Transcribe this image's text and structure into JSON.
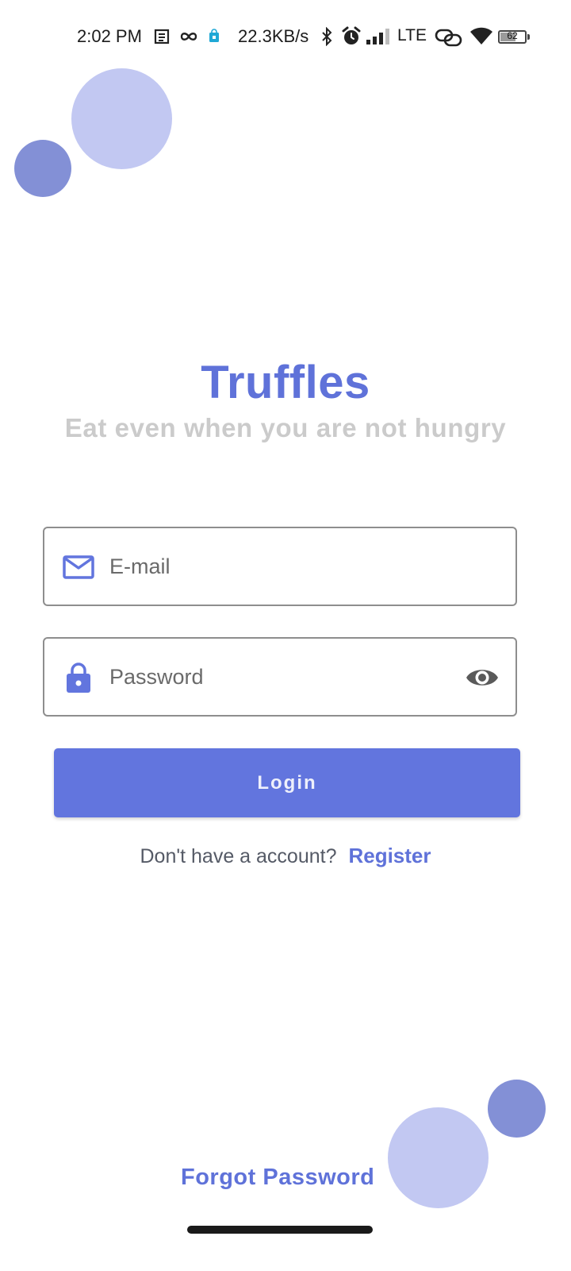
{
  "status_bar": {
    "time": "2:02 PM",
    "network_speed": "22.3KB/s",
    "network_type": "LTE",
    "battery_level": "62",
    "battery_fraction": 0.62,
    "icons": [
      "notes-icon",
      "infinity-icon",
      "shopping-bag-icon",
      "bluetooth-icon",
      "alarm-icon",
      "signal-icon",
      "link-icon",
      "wifi-icon",
      "battery-icon"
    ]
  },
  "app": {
    "title": "Truffles",
    "tagline": "Eat even when you are not hungry"
  },
  "form": {
    "email_placeholder": "E-mail",
    "email_value": "",
    "email_icon": "mail-icon",
    "password_placeholder": "Password",
    "password_value": "",
    "password_icon": "lock-icon",
    "visibility_icon": "eye-icon",
    "login_label": "Login"
  },
  "register": {
    "prompt": "Don't have a account?",
    "link_label": "Register"
  },
  "forgot_password_label": "Forgot Password",
  "colors": {
    "accent": "#5f72d9",
    "button": "#6275de",
    "circle_light": "#c2c8f2",
    "circle_dark": "#8390d6",
    "tagline": "#cbcbcb"
  }
}
